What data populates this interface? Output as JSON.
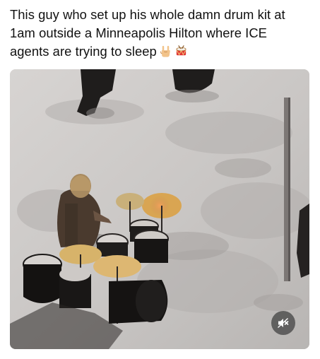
{
  "post": {
    "caption_lines": [
      "This guy who set up his whole damn drum kit at",
      "1am outside a Minneapolis Hilton where ICE",
      "agents are trying to sleep"
    ],
    "caption_emojis": [
      "rock-on-hand-emoji",
      "drum-emoji"
    ]
  },
  "media": {
    "type": "video",
    "mute_icon": "speaker-muted-icon"
  }
}
